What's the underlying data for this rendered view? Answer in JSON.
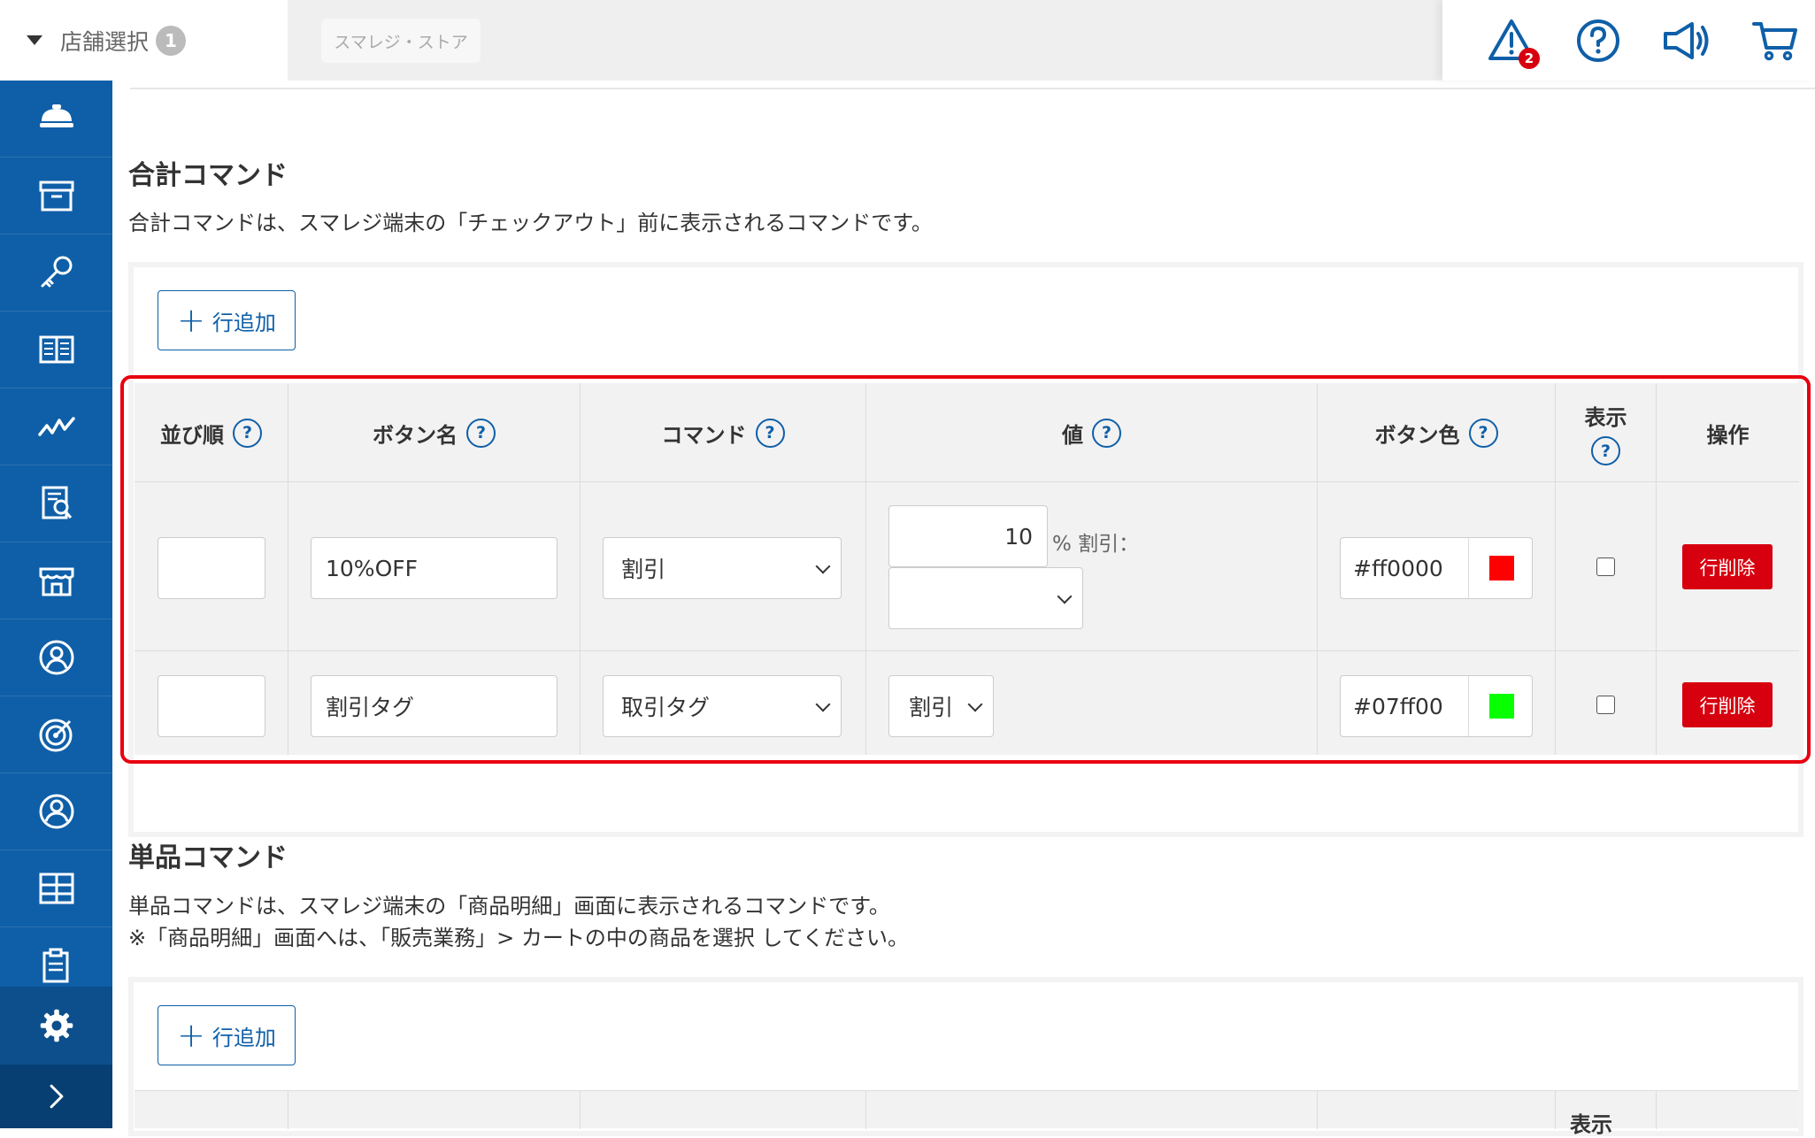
{
  "topbar": {
    "store_select_label": "店舗選択",
    "store_select_count": "1",
    "store_name": "スマレジ・ストア",
    "alert_badge_count": "2",
    "icons": [
      "alert-icon",
      "help-icon",
      "announcement-icon",
      "cart-icon"
    ]
  },
  "sidebar": {
    "items": [
      "home-icon",
      "archive-icon",
      "key-icon",
      "book-icon",
      "chart-icon",
      "report-icon",
      "store-icon",
      "customer-icon",
      "target-icon",
      "user-icon",
      "apps-icon",
      "clipboard-icon"
    ],
    "settings_icon": "gear-icon",
    "expand_icon": "chevron-right-icon"
  },
  "total_command": {
    "title": "合計コマンド",
    "description": "合計コマンドは、スマレジ端末の「チェックアウト」前に表示されるコマンドです。",
    "add_row_label": "行追加",
    "columns": [
      "並び順",
      "ボタン名",
      "コマンド",
      "値",
      "ボタン色",
      "表示",
      "操作"
    ],
    "rows": [
      {
        "order": "",
        "button_name": "10%OFF",
        "command": "割引",
        "value_number": "10",
        "value_suffix": "% 割引：",
        "value_select": "",
        "button_color": "#ff0000",
        "swatch": "#ff0000",
        "visible": false,
        "delete_label": "行削除"
      },
      {
        "order": "",
        "button_name": "割引タグ",
        "command": "取引タグ",
        "value_select": "割引",
        "button_color": "#07ff00",
        "swatch": "#07ff00",
        "visible": false,
        "delete_label": "行削除"
      }
    ]
  },
  "single_command": {
    "title": "単品コマンド",
    "description_line1": "単品コマンドは、スマレジ端末の「商品明細」画面に表示されるコマンドです。",
    "description_line2": "※「商品明細」画面へは、「販売業務」> カートの中の商品を選択 してください。",
    "add_row_label": "行追加",
    "partial_header": "表示"
  },
  "colors": {
    "accent": "#0f5fa8",
    "danger": "#d7000f",
    "highlight": "#e8000f"
  }
}
